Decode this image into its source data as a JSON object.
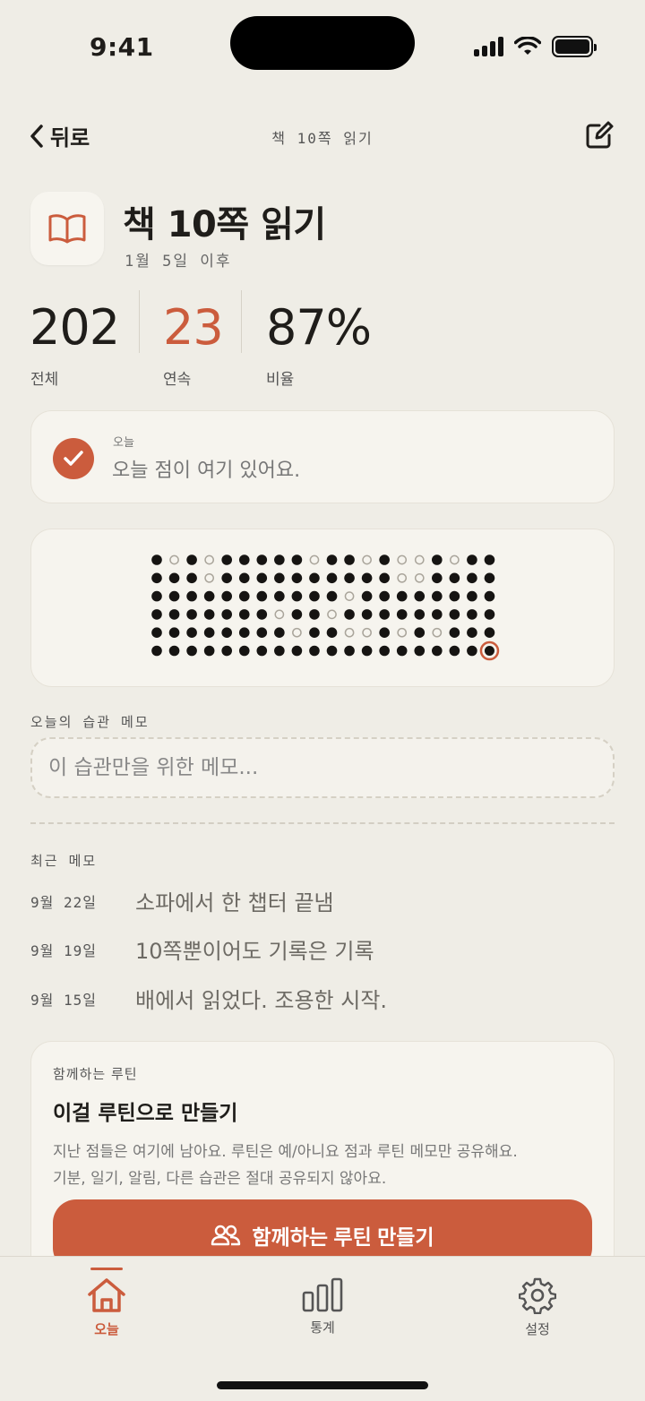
{
  "status": {
    "time": "9:41"
  },
  "nav": {
    "back_label": "뒤로",
    "title": "책 10쪽 읽기"
  },
  "habit": {
    "title": "책 10쪽 읽기",
    "since": "1월 5일 이후"
  },
  "stats": [
    {
      "value": "202",
      "label": "전체"
    },
    {
      "value": "23",
      "label": "연속"
    },
    {
      "value": "87%",
      "label": "비율"
    }
  ],
  "today": {
    "small_label": "오늘",
    "text": "오늘 점이 여기 있어요."
  },
  "dots": {
    "rows": [
      "XOXOXXXXXOXXOXOOXOXX",
      "XXXOXXXXXXXXXXOOXXXX",
      "XXXXXXXXXXXOXXXXXXXX",
      "XXXXXXXOXXOXXXXXXXXX",
      "XXXXXXXXOXXOOXOXOXXX",
      "XXXXXXXXXXXXXXXXXXXT"
    ],
    "legend": "X=done, O=missed, T=today"
  },
  "memo": {
    "label": "오늘의 습관 메모",
    "placeholder": "이 습관만을 위한 메모..."
  },
  "recent": {
    "label": "최근 메모",
    "items": [
      {
        "date": "9월 22일",
        "text": "소파에서 한 챕터 끝냄"
      },
      {
        "date": "9월 19일",
        "text": "10쪽뿐이어도 기록은 기록"
      },
      {
        "date": "9월 15일",
        "text": "배에서 읽었다. 조용한 시작."
      }
    ]
  },
  "routine": {
    "small_label": "함께하는 루틴",
    "title": "이걸 루틴으로 만들기",
    "desc_line1": "지난 점들은 여기에 남아요. 루틴은 예/아니요 점과 루틴 메모만 공유해요.",
    "desc_line2": "기분, 일기, 알림, 다른 습관은 절대 공유되지 않아요.",
    "button_label": "함께하는 루틴 만들기"
  },
  "tabs": [
    {
      "label": "오늘",
      "icon": "home-icon",
      "active": true
    },
    {
      "label": "통계",
      "icon": "bar-chart-icon",
      "active": false
    },
    {
      "label": "설정",
      "icon": "gear-icon",
      "active": false
    }
  ],
  "colors": {
    "accent": "#cb5c3d",
    "background": "#efede6",
    "card": "#f6f4ee"
  }
}
